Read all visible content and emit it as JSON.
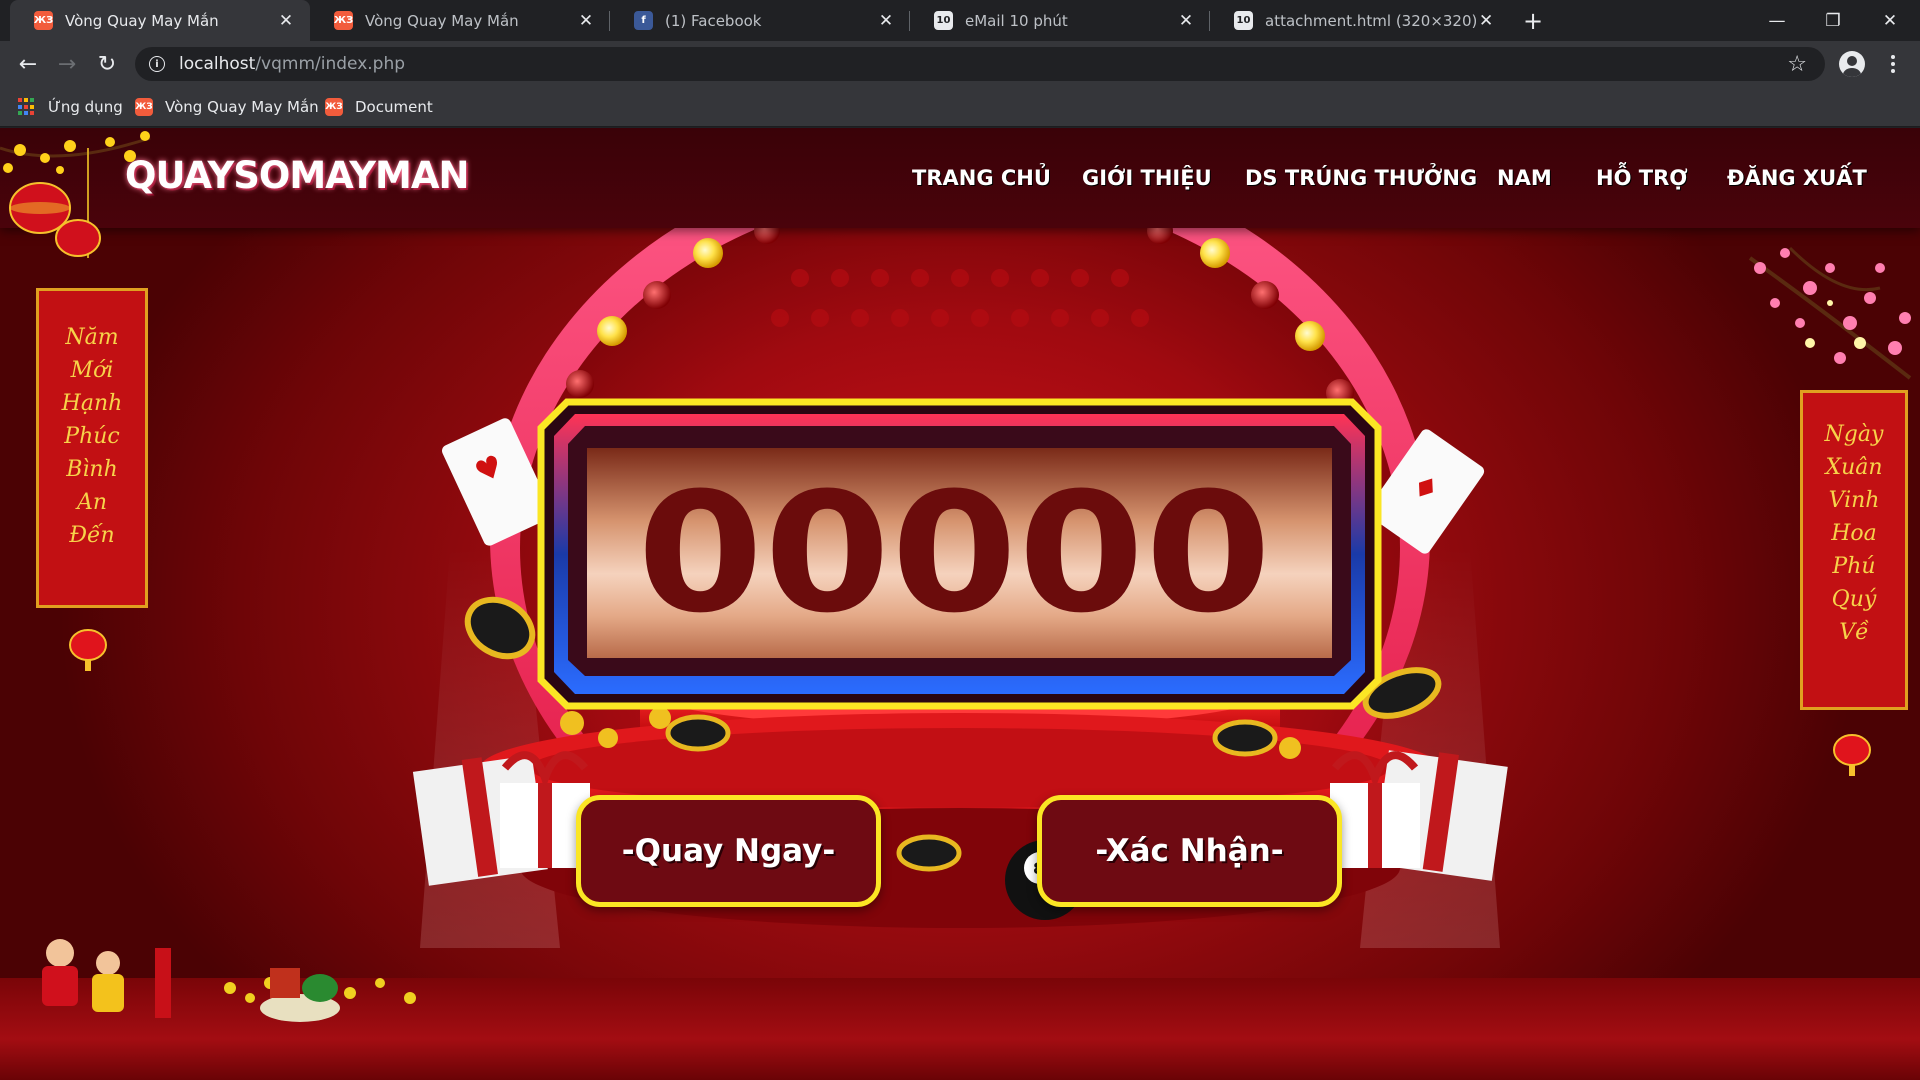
{
  "browser": {
    "tabs": [
      {
        "title": "Vòng Quay May Mắn",
        "active": true,
        "favicon": "xampp-icon"
      },
      {
        "title": "Vòng Quay May Mắn",
        "active": false,
        "favicon": "xampp-icon"
      },
      {
        "title": "(1) Facebook",
        "active": false,
        "favicon": "facebook-icon"
      },
      {
        "title": "eMail 10 phút",
        "active": false,
        "favicon": "ten-icon"
      },
      {
        "title": "attachment.html (320×320)",
        "active": false,
        "favicon": "ten-icon"
      }
    ],
    "url_host": "localhost",
    "url_path": "/vqmm/index.php",
    "bookmarks": [
      {
        "label": "Ứng dụng",
        "icon": "apps-grid-icon"
      },
      {
        "label": "Vòng Quay May Mắn",
        "icon": "xampp-icon"
      },
      {
        "label": "Document",
        "icon": "xampp-icon"
      }
    ],
    "favicon_text": {
      "xampp": "ЖЗ",
      "facebook": "f",
      "ten": "10"
    },
    "glyphs": {
      "close": "✕",
      "plus": "+",
      "back": "←",
      "forward": "→",
      "reload": "↻",
      "star": "☆",
      "minimize": "—",
      "restore": "❐",
      "window_close": "✕",
      "info": "i"
    }
  },
  "site": {
    "logo": "QUAYSOMAYMAN",
    "nav": [
      {
        "label": "TRANG CHỦ"
      },
      {
        "label": "GIỚI THIỆU"
      },
      {
        "label": "DS TRÚNG THƯỞNG"
      },
      {
        "label": "NAM"
      },
      {
        "label": "HỖ TRỢ"
      },
      {
        "label": "ĐĂNG XUẤT"
      }
    ],
    "banner_left": [
      "Năm",
      "Mới",
      "Hạnh",
      "Phúc",
      "Bình",
      "An",
      "Đến"
    ],
    "banner_right": [
      "Ngày",
      "Xuân",
      "Vinh",
      "Hoa",
      "Phú",
      "Quý",
      "Về"
    ],
    "digits": [
      "0",
      "0",
      "0",
      "0",
      "0"
    ],
    "buttons": {
      "spin": "-Quay Ngay-",
      "confirm": "-Xác Nhận-"
    }
  },
  "colors": {
    "page_red": "#c5161c",
    "header_maroon": "#3a0208",
    "button_fill": "#6e0a12",
    "button_border": "#fbe624",
    "digit_color": "#6b0c0c",
    "banner_gold": "#f7d34a"
  }
}
